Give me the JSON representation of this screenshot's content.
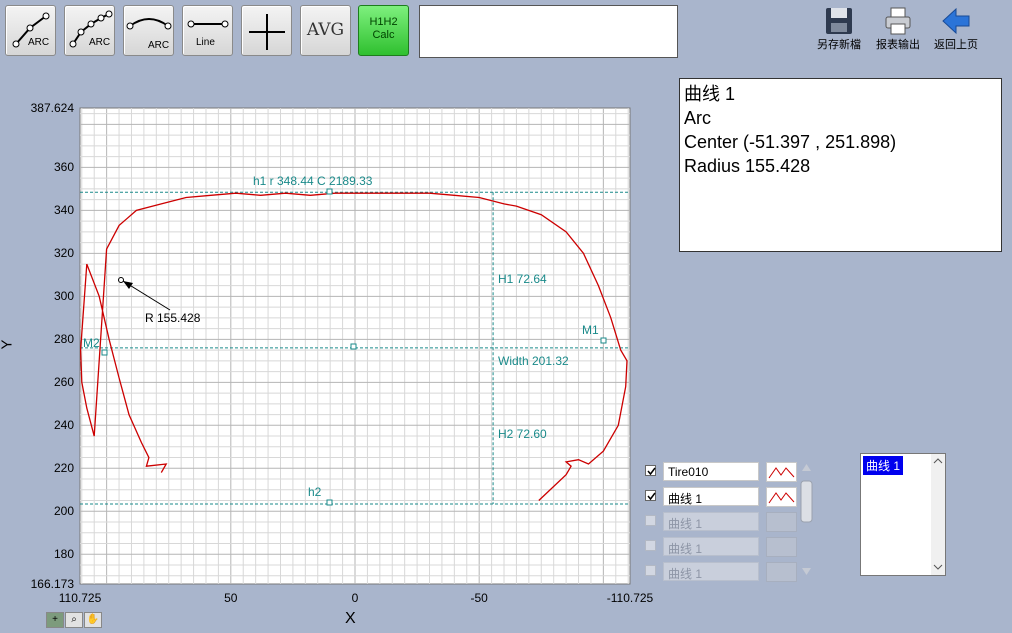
{
  "toolbar": {
    "arc3_label": "ARC",
    "arc5_label": "ARC",
    "arc_curve_label": "ARC",
    "line_label": "Line",
    "avg_label": "AVG",
    "calc_top": "H1H2",
    "calc_bottom": "Calc",
    "text_field_value": ""
  },
  "actions": {
    "save_new": "另存新檔",
    "report_export": "报表输出",
    "back": "返回上页"
  },
  "info": {
    "line1": "曲线 1",
    "line2": "Arc",
    "line3": "Center (-51.397 , 251.898)",
    "line4": "Radius 155.428"
  },
  "axes": {
    "y_title": "Y",
    "x_title": "X",
    "y_ticks": [
      "387.624",
      "360",
      "340",
      "320",
      "300",
      "280",
      "260",
      "240",
      "220",
      "200",
      "180",
      "166.173"
    ],
    "x_ticks": [
      "110.725",
      "50",
      "0",
      "-50",
      "-110.725"
    ]
  },
  "annotations": {
    "h1": "h1  r 348.44  C 2189.33",
    "h2": "h2",
    "H1": "H1  72.64",
    "H2": "H2  72.60",
    "width": "Width 201.32",
    "M1": "M1",
    "M2": "M2",
    "radius": "R 155.428"
  },
  "legend": [
    {
      "name": "Tire010",
      "checked": true,
      "enabled": true
    },
    {
      "name": "曲线 1",
      "checked": true,
      "enabled": true
    },
    {
      "name": "曲线 1",
      "checked": false,
      "enabled": false
    },
    {
      "name": "曲线 1",
      "checked": false,
      "enabled": false
    },
    {
      "name": "曲线 1",
      "checked": false,
      "enabled": false
    }
  ],
  "list": {
    "selected": "曲线 1"
  },
  "colors": {
    "curve": "#cc0000",
    "guide": "#1a8a8a",
    "calc_green": "#3fd33f"
  },
  "chart_data": {
    "type": "line",
    "xlim": [
      110.725,
      -110.725
    ],
    "ylim": [
      166.173,
      387.624
    ],
    "grid": true,
    "series": [
      {
        "name": "Tire010",
        "x": [
          78,
          76,
          84,
          83,
          86,
          91,
          95,
          99,
          103,
          108,
          110.5,
          110,
          108,
          105,
          100,
          95,
          88,
          78,
          68,
          58,
          48,
          38,
          28,
          18,
          8,
          0,
          -10,
          -20,
          -30,
          -40,
          -50,
          -60,
          -65,
          -75,
          -85,
          -92,
          -98,
          -103,
          -107,
          -109.5,
          -109,
          -106,
          -100,
          -94,
          -90,
          -85,
          -87,
          -85,
          -74
        ],
        "y": [
          218,
          222,
          221,
          225,
          232,
          245,
          262,
          280,
          300,
          315,
          275,
          260,
          248,
          235,
          322,
          333,
          340,
          343,
          346,
          347,
          348,
          347,
          348,
          347,
          348,
          348,
          348,
          348,
          348,
          347,
          346,
          343,
          342,
          338,
          330,
          320,
          305,
          290,
          275,
          270,
          258,
          240,
          228,
          222,
          224,
          223,
          221,
          217,
          205
        ]
      },
      {
        "name": "曲线 1",
        "type": "arc",
        "center": [
          -51.397,
          251.898
        ],
        "radius": 155.428
      }
    ]
  }
}
